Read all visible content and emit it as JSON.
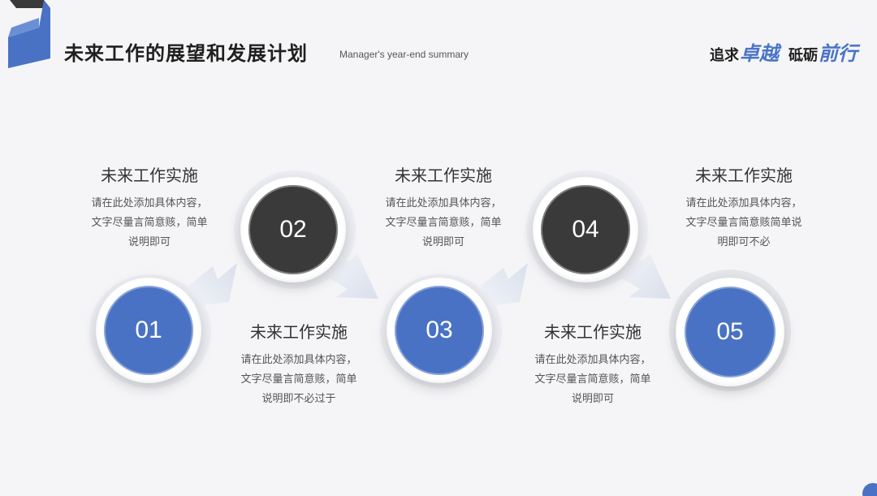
{
  "header": {
    "title": "未来工作的展望和发展计划",
    "subtitle": "Manager's year-end summary",
    "slogan": {
      "part1": "追求",
      "em1": "卓越",
      "part2": "砥砺",
      "em2": "前行"
    }
  },
  "steps": [
    {
      "number": "01",
      "heading": "未来工作实施",
      "lines": [
        "请在此处添加具体内容，",
        "文字尽量言简意赅，简单",
        "说明即可"
      ]
    },
    {
      "number": "02",
      "heading": "未来工作实施",
      "lines": [
        "请在此处添加具体内容，",
        "文字尽量言简意赅，简单",
        "说明即不必过于"
      ]
    },
    {
      "number": "03",
      "heading": "未来工作实施",
      "lines": [
        "请在此处添加具体内容，",
        "文字尽量言简意赅，简单",
        "说明即可"
      ]
    },
    {
      "number": "04",
      "heading": "未来工作实施",
      "lines": [
        "请在此处添加具体内容，",
        "文字尽量言简意赅，简单",
        "说明即可"
      ]
    },
    {
      "number": "05",
      "heading": "未来工作实施",
      "lines": [
        "请在此处添加具体内容，",
        "文字尽量言简意赅简单说",
        "明即可不必"
      ]
    }
  ],
  "colors": {
    "accent_blue": "#4a72c4",
    "dark": "#3a3a3a",
    "arrow": "#dfe4ee"
  }
}
